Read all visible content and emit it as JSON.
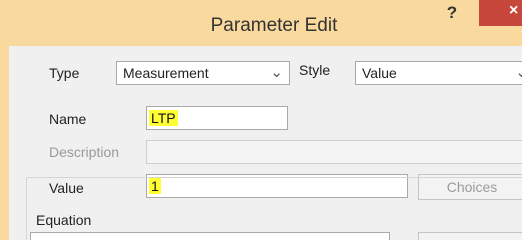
{
  "window": {
    "title": "Parameter Edit",
    "help_label": "?",
    "close_label": "×"
  },
  "form": {
    "type_label": "Type",
    "type_value": "Measurement",
    "style_label": "Style",
    "style_value": "Value",
    "name_label": "Name",
    "name_value": "LTP",
    "description_label": "Description",
    "description_value": "",
    "value_label": "Value",
    "value_value": "1",
    "choices_label": "Choices",
    "equation_label": "Equation"
  },
  "icons": {
    "dropdown": "chevron-down-icon",
    "help": "question-mark-icon",
    "close": "close-icon"
  },
  "colors": {
    "titlebar": "#fad99e",
    "close_button": "#c7473c",
    "highlight": "#ffff33",
    "client_background": "#f0f0f0"
  }
}
